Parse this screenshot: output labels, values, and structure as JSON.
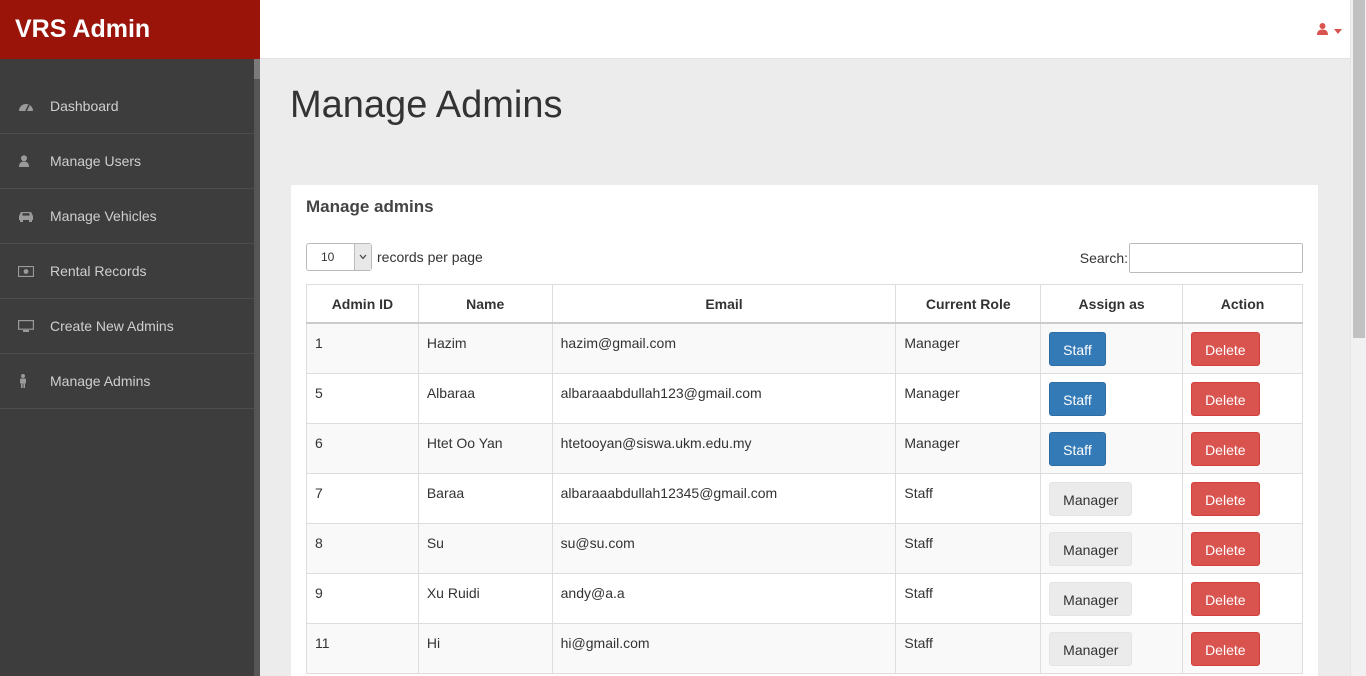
{
  "brand": {
    "title": "VRS Admin"
  },
  "sidebar": {
    "items": [
      {
        "label": "Dashboard",
        "icon": "dashboard-icon"
      },
      {
        "label": "Manage Users",
        "icon": "user-icon"
      },
      {
        "label": "Manage Vehicles",
        "icon": "car-icon"
      },
      {
        "label": "Rental Records",
        "icon": "money-icon"
      },
      {
        "label": "Create New Admins",
        "icon": "desktop-icon"
      },
      {
        "label": "Manage Admins",
        "icon": "male-icon"
      }
    ]
  },
  "topbar": {
    "user_icon": "user-icon",
    "accent": "#d9534f"
  },
  "page": {
    "title": "Manage Admins"
  },
  "panel": {
    "title": "Manage admins",
    "length": {
      "value": "10",
      "label": "records per page"
    },
    "search": {
      "label": "Search:",
      "value": ""
    },
    "columns": [
      "Admin ID",
      "Name",
      "Email",
      "Current Role",
      "Assign as",
      "Action"
    ],
    "rows": [
      {
        "id": "1",
        "name": "Hazim",
        "email": "hazim@gmail.com",
        "role": "Manager",
        "assign": "Staff",
        "action": "Delete"
      },
      {
        "id": "5",
        "name": "Albaraa",
        "email": "albaraaabdullah123@gmail.com",
        "role": "Manager",
        "assign": "Staff",
        "action": "Delete"
      },
      {
        "id": "6",
        "name": "Htet Oo Yan",
        "email": "htetooyan@siswa.ukm.edu.my",
        "role": "Manager",
        "assign": "Staff",
        "action": "Delete"
      },
      {
        "id": "7",
        "name": "Baraa",
        "email": "albaraaabdullah12345@gmail.com",
        "role": "Staff",
        "assign": "Manager",
        "action": "Delete"
      },
      {
        "id": "8",
        "name": "Su",
        "email": "su@su.com",
        "role": "Staff",
        "assign": "Manager",
        "action": "Delete"
      },
      {
        "id": "9",
        "name": "Xu Ruidi",
        "email": "andy@a.a",
        "role": "Staff",
        "assign": "Manager",
        "action": "Delete"
      },
      {
        "id": "11",
        "name": "Hi",
        "email": "hi@gmail.com",
        "role": "Staff",
        "assign": "Manager",
        "action": "Delete"
      }
    ]
  },
  "colors": {
    "brand": "#9a1409",
    "sidebar": "#3d3d3d",
    "primary": "#337ab7",
    "danger": "#d9534f"
  }
}
